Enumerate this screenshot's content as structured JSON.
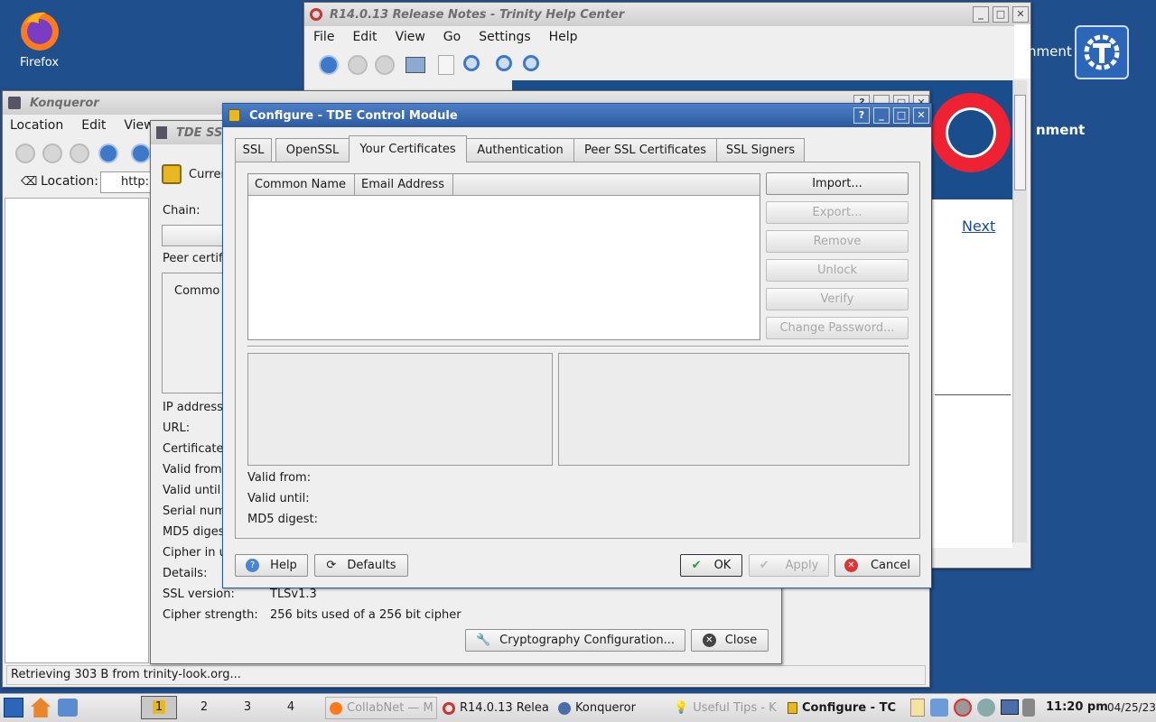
{
  "desktop": {
    "firefox_label": "Firefox",
    "bg_color": "#1f4f8c"
  },
  "help_center": {
    "title": "R14.0.13 Release Notes - Trinity Help Center",
    "menu": [
      "File",
      "Edit",
      "View",
      "Go",
      "Settings",
      "Help"
    ],
    "next_link": "Next",
    "banner_fragment": "nment"
  },
  "konqueror": {
    "title": "Konqueror",
    "menu": [
      "Location",
      "Edit",
      "View"
    ],
    "location_label": "Location:",
    "location_value": "http:",
    "status": "Retrieving 303 B from trinity-look.org..."
  },
  "ssl_dialog": {
    "title": "TDE SS",
    "current": "Curren",
    "chain_label": "Chain:",
    "peer_label": "Peer certif",
    "common": "Commo",
    "fields": [
      "IP address",
      "URL:",
      "Certificate",
      "Valid from",
      "Valid until",
      "Serial num",
      "MD5 diges",
      "Cipher in u",
      "Details:"
    ],
    "ssl_version_label": "SSL version:",
    "ssl_version_value": "TLSv1.3",
    "cipher_strength_label": "Cipher strength:",
    "cipher_strength_value": "256 bits used of a 256 bit cipher",
    "crypto_button": "Cryptography Configuration...",
    "close_button": "Close"
  },
  "configure": {
    "title": "Configure - TDE Control Module",
    "tabs": [
      "SSL",
      "OpenSSL",
      "Your Certificates",
      "Authentication",
      "Peer SSL Certificates",
      "SSL Signers"
    ],
    "selected_tab": "Your Certificates",
    "columns": [
      "Common Name",
      "Email Address"
    ],
    "side_buttons": [
      "Import...",
      "Export...",
      "Remove",
      "Unlock",
      "Verify",
      "Change Password..."
    ],
    "valid_from": "Valid from:",
    "valid_until": "Valid until:",
    "md5_digest": "MD5 digest:",
    "help_button": "Help",
    "defaults_button": "Defaults",
    "ok_button": "OK",
    "apply_button": "Apply",
    "cancel_button": "Cancel"
  },
  "taskbar": {
    "desktops": [
      "1",
      "2",
      "3",
      "4"
    ],
    "tasks": [
      "CollabNet — M",
      "R14.0.13 Relea",
      "Konqueror",
      "Useful Tips - K",
      "Configure - TC"
    ],
    "time": "11:20 pm",
    "date": "04/25/23"
  }
}
